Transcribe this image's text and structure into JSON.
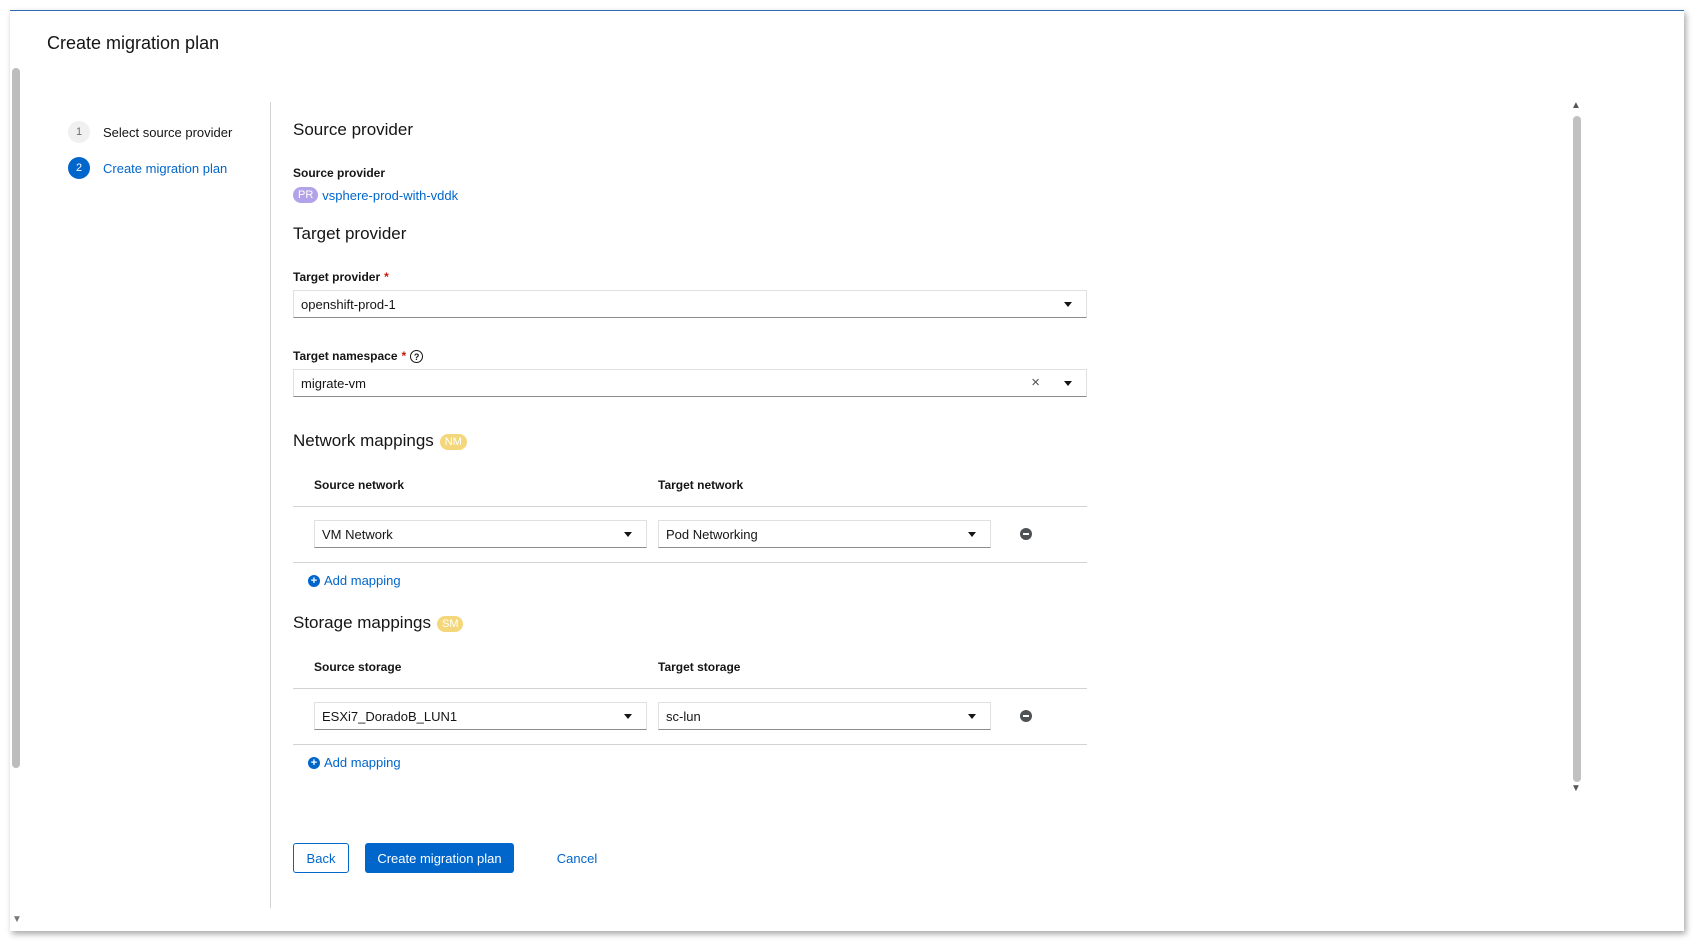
{
  "page": {
    "title": "Create migration plan"
  },
  "wizard": {
    "steps": [
      {
        "number": "1",
        "label": "Select source provider",
        "state": "inactive"
      },
      {
        "number": "2",
        "label": "Create migration plan",
        "state": "active"
      }
    ]
  },
  "source_provider": {
    "heading": "Source provider",
    "label": "Source provider",
    "badge": "PR",
    "value": "vsphere-prod-with-vddk"
  },
  "target_provider": {
    "heading": "Target provider",
    "provider_label": "Target provider",
    "provider_required": "*",
    "provider_value": "openshift-prod-1",
    "namespace_label": "Target namespace",
    "namespace_required": "*",
    "namespace_help": "?",
    "namespace_value": "migrate-vm",
    "namespace_clear": "×"
  },
  "network_mappings": {
    "heading": "Network mappings",
    "badge": "NM",
    "col_source": "Source network",
    "col_target": "Target network",
    "rows": [
      {
        "source": "VM Network",
        "target": "Pod Networking"
      }
    ],
    "add_label": "Add mapping"
  },
  "storage_mappings": {
    "heading": "Storage mappings",
    "badge": "SM",
    "col_source": "Source storage",
    "col_target": "Target storage",
    "rows": [
      {
        "source": "ESXi7_DoradoB_LUN1",
        "target": "sc-lun"
      }
    ],
    "add_label": "Add mapping"
  },
  "footer": {
    "back_label": "Back",
    "create_label": "Create migration plan",
    "cancel_label": "Cancel"
  },
  "colors": {
    "accent": "#0066cc",
    "badge_pr": "#b2a3e8",
    "badge_nm": "#f4d77a",
    "required": "#c9190b"
  },
  "icons": {
    "dropdown": "caret-down-icon",
    "clear": "close-icon",
    "remove": "minus-circle-icon",
    "add": "plus-circle-icon",
    "help": "question-circle-icon"
  }
}
